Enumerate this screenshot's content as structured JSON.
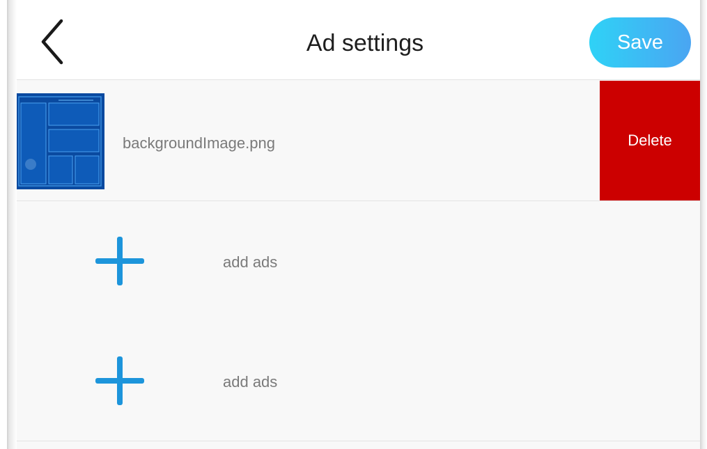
{
  "header": {
    "back_icon": "chevron-left-icon",
    "title": "Ad settings",
    "save_label": "Save"
  },
  "ads": {
    "image_item": {
      "file_name": "backgroundImage.png",
      "delete_label": "Delete"
    },
    "add_slots": [
      {
        "icon": "plus-icon",
        "label": "add ads"
      },
      {
        "icon": "plus-icon",
        "label": "add ads"
      }
    ]
  },
  "colors": {
    "save_gradient_start": "#2fd2f6",
    "save_gradient_end": "#4aa5f2",
    "delete_red": "#cc0000",
    "plus_blue": "#1d95db",
    "muted_text": "#7a7a7a"
  }
}
